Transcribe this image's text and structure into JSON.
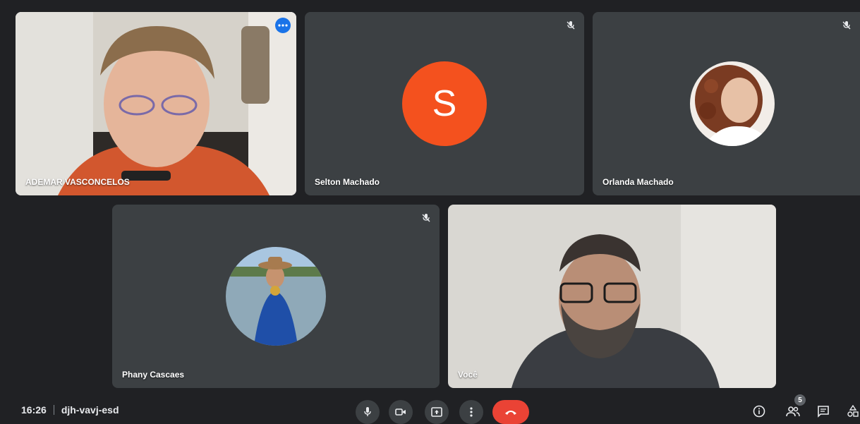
{
  "participants": [
    {
      "name": "ADEMAR VASCONCELOS",
      "type": "video",
      "active": true
    },
    {
      "name": "Selton Machado",
      "type": "letter-avatar",
      "initial": "S",
      "avatar_color": "#f4511e",
      "muted": true
    },
    {
      "name": "Orlanda Machado",
      "type": "photo-avatar",
      "muted": true
    },
    {
      "name": "Phany Cascaes",
      "type": "photo-avatar",
      "muted": true
    },
    {
      "name": "Você",
      "type": "video"
    }
  ],
  "meeting": {
    "time": "16:26",
    "code": "djh-vavj-esd"
  },
  "people_count": "5",
  "icons": {
    "mic": "mic-icon",
    "camera": "camera-icon",
    "present": "present-screen-icon",
    "more": "more-vert-icon",
    "end_call": "end-call-icon",
    "info": "info-icon",
    "people": "people-icon",
    "chat": "chat-icon",
    "activities": "activities-icon"
  },
  "colors": {
    "background": "#202124",
    "tile": "#3c4043",
    "end_call": "#ea4335",
    "active_outline": "#8ab4f8"
  }
}
